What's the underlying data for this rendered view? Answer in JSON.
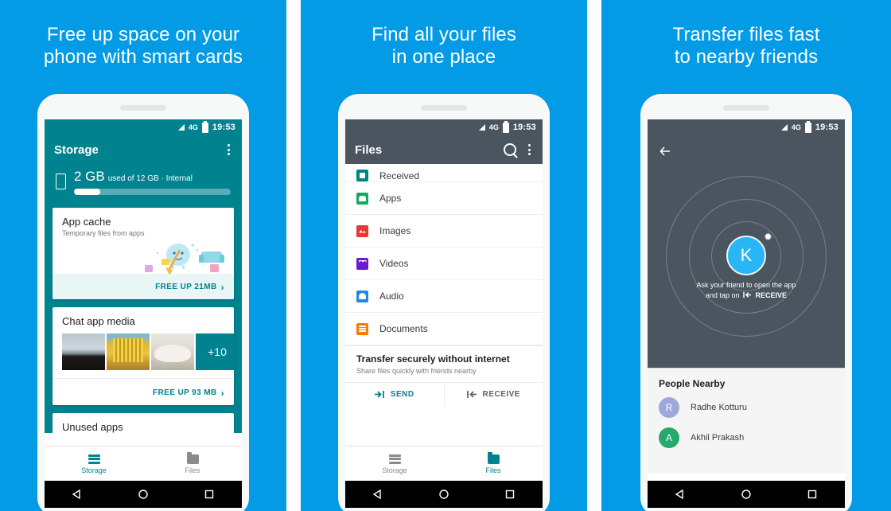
{
  "theme": {
    "background_blue": "#039BE5",
    "teal": "#00838F",
    "dark_slate": "#4A5560",
    "accent_light_blue": "#29B6F6"
  },
  "panels": [
    {
      "headline_line1": "Free up space on your",
      "headline_line2": "phone with smart cards",
      "status_bar": {
        "network": "4G",
        "time": "19:53"
      },
      "toolbar_title": "Storage",
      "storage": {
        "used": "2 GB",
        "detail": "used of 12 GB · Internal",
        "percent_used": 17
      },
      "cards": [
        {
          "title": "App cache",
          "subtitle": "Temporary files from apps",
          "action": "FREE UP 21MB"
        },
        {
          "title": "Chat app media",
          "more_count": "+10",
          "action": "FREE UP 93 MB"
        },
        {
          "title": "Unused apps"
        }
      ],
      "tabs": [
        {
          "label": "Storage",
          "icon": "storage-icon",
          "active": true
        },
        {
          "label": "Files",
          "icon": "folder-icon",
          "active": false
        }
      ]
    },
    {
      "headline_line1": "Find all your files",
      "headline_line2": "in one place",
      "status_bar": {
        "network": "4G",
        "time": "19:53"
      },
      "toolbar_title": "Files",
      "toolbar_icons": [
        "search-icon",
        "overflow-menu-icon"
      ],
      "file_categories": [
        {
          "label": "Received",
          "color": "#00838F",
          "clipped": true
        },
        {
          "label": "Apps",
          "color": "#15A85F"
        },
        {
          "label": "Images",
          "color": "#E53935"
        },
        {
          "label": "Videos",
          "color": "#6A1BD1"
        },
        {
          "label": "Audio",
          "color": "#1E88E5"
        },
        {
          "label": "Documents",
          "color": "#F57C00"
        }
      ],
      "transfer": {
        "title": "Transfer securely without internet",
        "subtitle": "Share files quickly with friends nearby",
        "send_label": "SEND",
        "receive_label": "RECEIVE"
      },
      "tabs": [
        {
          "label": "Storage",
          "icon": "storage-icon",
          "active": false
        },
        {
          "label": "Files",
          "icon": "folder-icon",
          "active": true
        }
      ]
    },
    {
      "headline_line1": "Transfer files fast",
      "headline_line2": "to nearby friends",
      "status_bar": {
        "network": "4G",
        "time": "19:53"
      },
      "back_icon": "back-arrow-icon",
      "radar": {
        "avatar_initial": "K",
        "bluetooth_icon": "bluetooth-icon",
        "hint_line1": "Ask your friend to open the app",
        "hint_line2_prefix": "and tap on",
        "hint_line2_action": "RECEIVE"
      },
      "people_nearby": {
        "title": "People Nearby",
        "list": [
          {
            "initial": "R",
            "name": "Radhe Kotturu",
            "color": "#9FA8DA"
          },
          {
            "initial": "A",
            "name": "Akhil Prakash",
            "color": "#26A96C"
          }
        ]
      }
    }
  ]
}
